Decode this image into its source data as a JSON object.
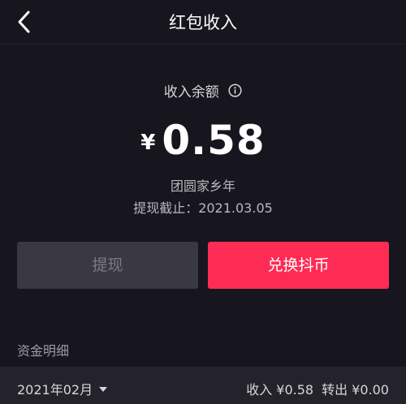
{
  "header": {
    "title": "红包收入",
    "back_icon": "chevron-left-icon"
  },
  "balance": {
    "label": "收入余额",
    "info_icon": "info-icon",
    "currency_symbol": "¥",
    "amount": "0.58",
    "source": "团圆家乡年",
    "deadline": "提现截止：2021.03.05"
  },
  "actions": {
    "withdraw_label": "提现",
    "exchange_label": "兑换抖币"
  },
  "details": {
    "section_title": "资金明细",
    "month": "2021年02月",
    "income": "收入 ¥0.58",
    "outgoing": "转出 ¥0.00"
  },
  "colors": {
    "background": "#17161e",
    "accent": "#fe2c55",
    "disabled_button": "#3a3942"
  }
}
